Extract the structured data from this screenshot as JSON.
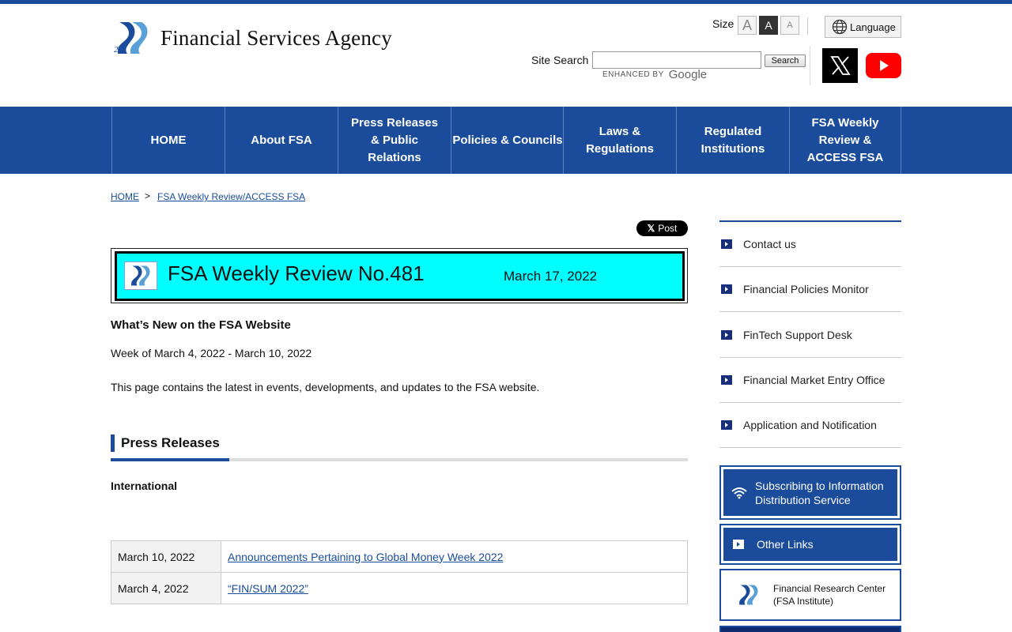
{
  "header": {
    "logo_text": "Financial Services Agency",
    "size_label": "Size",
    "size_options": [
      "A",
      "A",
      "A"
    ],
    "language_label": "Language",
    "search_label": "Site Search",
    "search_value": "",
    "search_button": "Search",
    "enhanced_by": "ENHANCED BY",
    "google": "Google"
  },
  "nav": {
    "items": [
      {
        "label": "HOME"
      },
      {
        "label": "About FSA"
      },
      {
        "label": "Press Releases & Public Relations"
      },
      {
        "label": "Policies & Councils"
      },
      {
        "label": "Laws & Regulations"
      },
      {
        "label": "Regulated Institutions"
      },
      {
        "label": "FSA Weekly Review & ACCESS FSA"
      }
    ]
  },
  "breadcrumb": {
    "home": "HOME",
    "separator": ">",
    "current": "FSA Weekly Review/ACCESS FSA"
  },
  "post_button": "Post",
  "main": {
    "title": "FSA Weekly Review No.481",
    "date": "March 17, 2022",
    "whats_new_heading": "What’s New on the FSA Website",
    "week": "Week of March 4, 2022 - March 10, 2022",
    "intro": "This page contains the latest in events, developments, and updates to the FSA website.",
    "press_releases_heading": "Press Releases",
    "category": "International",
    "rows": [
      {
        "date": "March 10, 2022",
        "title": "Announcements Pertaining to Global Money Week 2022"
      },
      {
        "date": "March 4, 2022",
        "title": "“FIN/SUM 2022”"
      }
    ]
  },
  "sidebar": {
    "items": [
      {
        "label": "Contact us"
      },
      {
        "label": "Financial Policies Monitor"
      },
      {
        "label": "FinTech Support Desk"
      },
      {
        "label": "Financial Market Entry Office"
      },
      {
        "label": "Application and Notification"
      }
    ],
    "subscribe": "Subscribing to Information Distribution Service",
    "other_links": "Other Links",
    "research_center_line1": "Financial Research Center",
    "research_center_line2": "(FSA Institute)"
  },
  "colors": {
    "brand_blue": "#1a4c9b",
    "title_bg": "#00ffff"
  }
}
